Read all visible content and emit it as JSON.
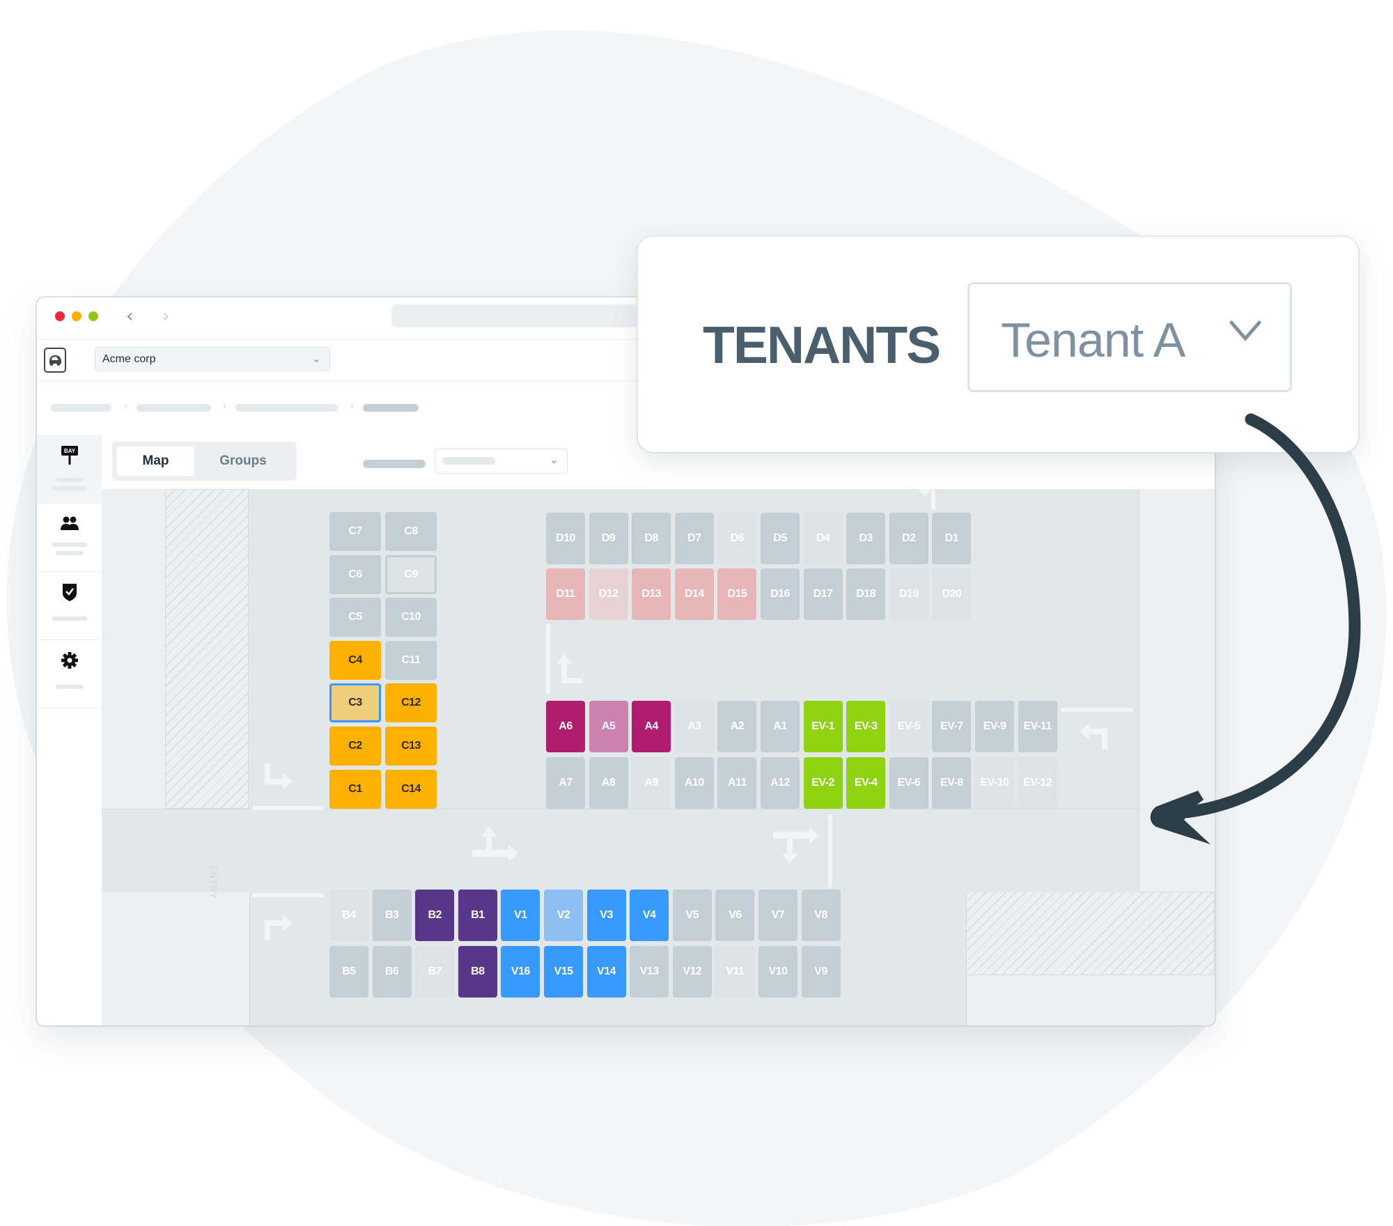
{
  "window": {
    "traffic_lights": [
      "#e8293b",
      "#fbb000",
      "#96c21e"
    ],
    "nav": {
      "back": "‹",
      "forward": "›"
    }
  },
  "header": {
    "org_select": {
      "value": "Acme corp",
      "chevron": "⌄"
    }
  },
  "sidebar": {
    "items": [
      {
        "icon": "bay-sign-icon",
        "icon_text": "BAY",
        "active": true
      },
      {
        "icon": "users-icon",
        "active": false
      },
      {
        "icon": "shield-check-icon",
        "active": false
      },
      {
        "icon": "gear-icon",
        "active": false
      }
    ]
  },
  "toolbar": {
    "tabs": [
      {
        "label": "Map",
        "active": true
      },
      {
        "label": "Groups",
        "active": false
      }
    ],
    "select_chevron": "⌄"
  },
  "map": {
    "entry_label": "ENTRY",
    "colors": {
      "available": "#c3ced5",
      "disabled": "#dce2e6",
      "tenant_c": "#ffb000",
      "tenant_c_selected": "#f0cd7a",
      "tenant_d": "#e9b6b8",
      "tenant_d_light": "#e8d1d3",
      "tenant_a": "#b01c6f",
      "tenant_a_light": "#cc82ae",
      "ev": "#8fd210",
      "tenant_b": "#573789",
      "visitor": "#3899fc",
      "visitor_light": "#8ebff3",
      "selected_border": "#3899fc"
    },
    "sections": {
      "C": {
        "col1": [
          {
            "label": "C7",
            "state": "available"
          },
          {
            "label": "C6",
            "state": "available"
          },
          {
            "label": "C5",
            "state": "available"
          },
          {
            "label": "C4",
            "state": "tenant_c"
          },
          {
            "label": "C3",
            "state": "tenant_c_selected"
          },
          {
            "label": "C2",
            "state": "tenant_c"
          },
          {
            "label": "C1",
            "state": "tenant_c"
          }
        ],
        "col2": [
          {
            "label": "C8",
            "state": "available"
          },
          {
            "label": "C9",
            "state": "outlined"
          },
          {
            "label": "C10",
            "state": "available"
          },
          {
            "label": "C11",
            "state": "available"
          },
          {
            "label": "C12",
            "state": "tenant_c"
          },
          {
            "label": "C13",
            "state": "tenant_c"
          },
          {
            "label": "C14",
            "state": "tenant_c"
          }
        ]
      },
      "D": {
        "row1": [
          {
            "label": "D10",
            "state": "available"
          },
          {
            "label": "D9",
            "state": "available"
          },
          {
            "label": "D8",
            "state": "available"
          },
          {
            "label": "D7",
            "state": "available"
          },
          {
            "label": "D6",
            "state": "disabled"
          },
          {
            "label": "D5",
            "state": "available"
          },
          {
            "label": "D4",
            "state": "disabled"
          },
          {
            "label": "D3",
            "state": "available"
          },
          {
            "label": "D2",
            "state": "available"
          },
          {
            "label": "D1",
            "state": "available"
          }
        ],
        "row2": [
          {
            "label": "D11",
            "state": "tenant_d"
          },
          {
            "label": "D12",
            "state": "tenant_d_light"
          },
          {
            "label": "D13",
            "state": "tenant_d"
          },
          {
            "label": "D14",
            "state": "tenant_d"
          },
          {
            "label": "D15",
            "state": "tenant_d"
          },
          {
            "label": "D16",
            "state": "available"
          },
          {
            "label": "D17",
            "state": "available"
          },
          {
            "label": "D18",
            "state": "available"
          },
          {
            "label": "D19",
            "state": "disabled"
          },
          {
            "label": "D20",
            "state": "disabled"
          }
        ]
      },
      "A": {
        "row1": [
          {
            "label": "A6",
            "state": "tenant_a"
          },
          {
            "label": "A5",
            "state": "tenant_a_light"
          },
          {
            "label": "A4",
            "state": "tenant_a"
          },
          {
            "label": "A3",
            "state": "disabled"
          },
          {
            "label": "A2",
            "state": "available"
          },
          {
            "label": "A1",
            "state": "available"
          },
          {
            "label": "EV-1",
            "state": "ev"
          },
          {
            "label": "EV-3",
            "state": "ev"
          },
          {
            "label": "EV-5",
            "state": "disabled"
          },
          {
            "label": "EV-7",
            "state": "available"
          },
          {
            "label": "EV-9",
            "state": "available"
          },
          {
            "label": "EV-11",
            "state": "available"
          }
        ],
        "row2": [
          {
            "label": "A7",
            "state": "available"
          },
          {
            "label": "A8",
            "state": "available"
          },
          {
            "label": "A9",
            "state": "disabled"
          },
          {
            "label": "A10",
            "state": "available"
          },
          {
            "label": "A11",
            "state": "available"
          },
          {
            "label": "A12",
            "state": "available"
          },
          {
            "label": "EV-2",
            "state": "ev"
          },
          {
            "label": "EV-4",
            "state": "ev"
          },
          {
            "label": "EV-6",
            "state": "available"
          },
          {
            "label": "EV-8",
            "state": "available"
          },
          {
            "label": "EV-10",
            "state": "disabled"
          },
          {
            "label": "EV-12",
            "state": "disabled"
          }
        ]
      },
      "B": {
        "row1": [
          {
            "label": "B4",
            "state": "disabled"
          },
          {
            "label": "B3",
            "state": "available"
          },
          {
            "label": "B2",
            "state": "tenant_b"
          },
          {
            "label": "B1",
            "state": "tenant_b"
          },
          {
            "label": "V1",
            "state": "visitor"
          },
          {
            "label": "V2",
            "state": "visitor_light"
          },
          {
            "label": "V3",
            "state": "visitor"
          },
          {
            "label": "V4",
            "state": "visitor"
          },
          {
            "label": "V5",
            "state": "available"
          },
          {
            "label": "V6",
            "state": "available"
          },
          {
            "label": "V7",
            "state": "available"
          },
          {
            "label": "V8",
            "state": "available"
          }
        ],
        "row2": [
          {
            "label": "B5",
            "state": "available"
          },
          {
            "label": "B6",
            "state": "available"
          },
          {
            "label": "B7",
            "state": "disabled"
          },
          {
            "label": "B8",
            "state": "tenant_b"
          },
          {
            "label": "V16",
            "state": "visitor"
          },
          {
            "label": "V15",
            "state": "visitor"
          },
          {
            "label": "V14",
            "state": "visitor"
          },
          {
            "label": "V13",
            "state": "available"
          },
          {
            "label": "V12",
            "state": "available"
          },
          {
            "label": "V11",
            "state": "disabled"
          },
          {
            "label": "V10",
            "state": "available"
          },
          {
            "label": "V9",
            "state": "available"
          }
        ]
      }
    }
  },
  "tenant_popup": {
    "label": "TENANTS",
    "select_value": "Tenant A",
    "label_color": "#4a5f6d",
    "value_color": "#7d929e",
    "arrow_color": "#2b3e47"
  }
}
